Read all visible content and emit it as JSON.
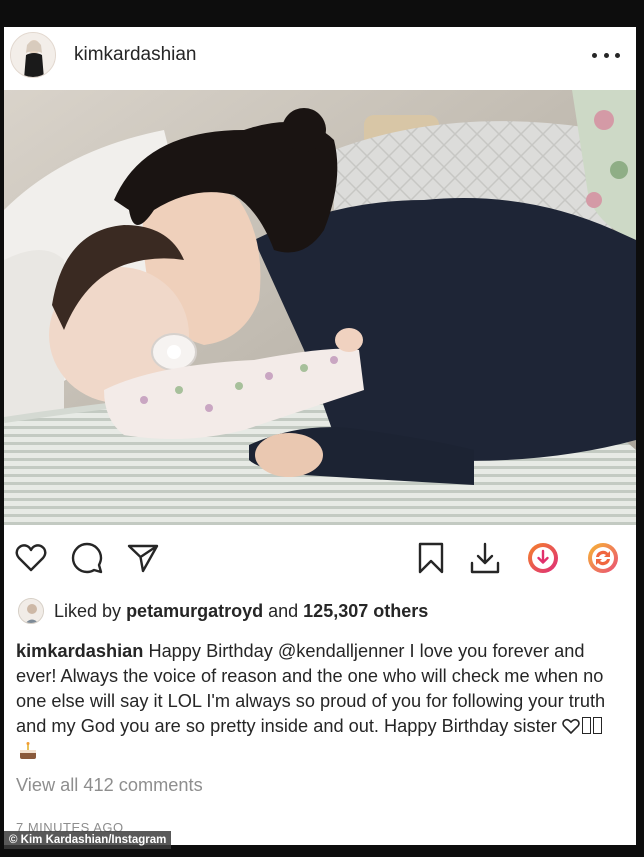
{
  "post": {
    "username": "kimkardashian",
    "more_icon": "more-horizontal-icon",
    "photo_description_icon": "photo"
  },
  "actions": {
    "like_icon": "heart-icon",
    "comment_icon": "comment-icon",
    "share_icon": "send-icon",
    "save_icon": "bookmark-icon",
    "download_icon": "download-icon",
    "download_circle_icon": "download-circle-icon",
    "repost_icon": "repost-icon"
  },
  "likes": {
    "prefix": "Liked by",
    "user": "petamurgatroyd",
    "joiner": "and",
    "count": "125,307 others"
  },
  "caption": {
    "user": "kimkardashian",
    "text": "Happy Birthday @kendalljenner I love you forever and ever! Always the voice of reason and the one who will check me when no one else will say it LOL I'm always so proud of you for following your truth and my God you are so pretty inside and out. Happy Birthday sister"
  },
  "comments": {
    "view_all": "View all 412 comments"
  },
  "timestamp": "7 MINUTES AGO",
  "credit": "© Kim Kardashian/Instagram",
  "colors": {
    "text": "#262626",
    "muted": "#8e8e8e",
    "accent_orange": "#f5763b",
    "accent_pink": "#e1306c"
  }
}
